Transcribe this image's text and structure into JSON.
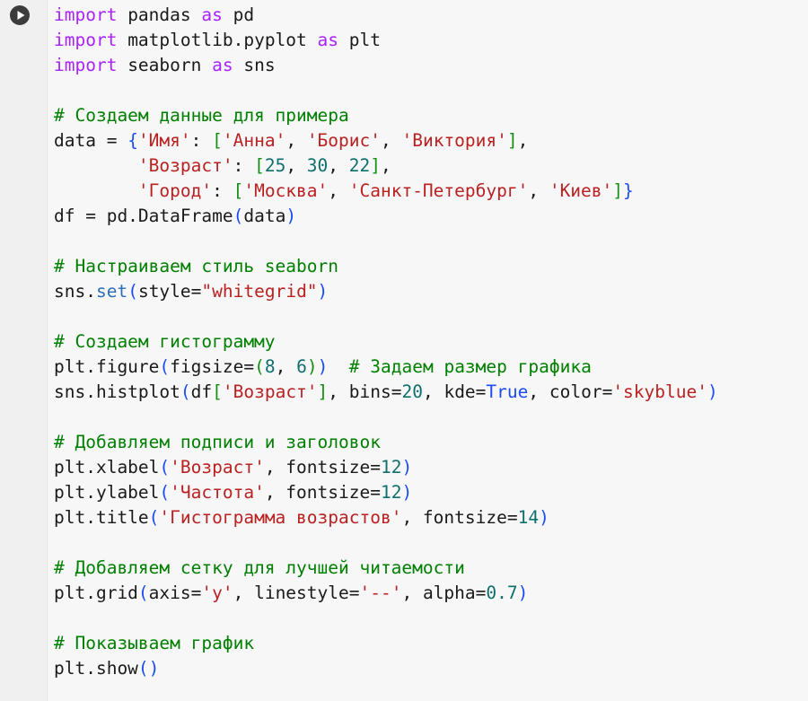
{
  "editor": {
    "kind": "notebook-code-cell",
    "language": "python",
    "background_color": "#f7f7f7",
    "gutter_color": "#f0f0f0",
    "run_button": {
      "icon": "play-icon",
      "label": "Run cell",
      "circle_color": "#3c3c3c",
      "glyph_color": "#ffffff"
    },
    "syntax_colors": {
      "keyword": "#aa22ff",
      "comment": "#008000",
      "string": "#ba2121",
      "number": "#0f6f6f",
      "boolean": "#1a4cf5",
      "function": "#2e6fb7",
      "bracket_level_1": "#1a4cf5",
      "bracket_level_2": "#149014",
      "text": "#1a1a1a"
    }
  },
  "code": {
    "lines": [
      "import pandas as pd",
      "import matplotlib.pyplot as plt",
      "import seaborn as sns",
      "",
      "# Создаем данные для примера",
      "data = {'Имя': ['Анна', 'Борис', 'Виктория'],",
      "        'Возраст': [25, 30, 22],",
      "        'Город': ['Москва', 'Санкт-Петербург', 'Киев']}",
      "df = pd.DataFrame(data)",
      "",
      "# Настраиваем стиль seaborn",
      "sns.set(style=\"whitegrid\")",
      "",
      "# Создаем гистограмму",
      "plt.figure(figsize=(8, 6))  # Задаем размер графика",
      "sns.histplot(df['Возраст'], bins=20, kde=True, color='skyblue')",
      "",
      "# Добавляем подписи и заголовок",
      "plt.xlabel('Возраст', fontsize=12)",
      "plt.ylabel('Частота', fontsize=12)",
      "plt.title('Гистограмма возрастов', fontsize=14)",
      "",
      "# Добавляем сетку для лучшей читаемости",
      "plt.grid(axis='y', linestyle='--', alpha=0.7)",
      "",
      "# Показываем график",
      "plt.show()"
    ],
    "tokens": [
      [
        [
          "import",
          "kw"
        ],
        [
          " pandas ",
          "plain"
        ],
        [
          "as",
          "kw"
        ],
        [
          " pd",
          "plain"
        ]
      ],
      [
        [
          "import",
          "kw"
        ],
        [
          " matplotlib.pyplot ",
          "plain"
        ],
        [
          "as",
          "kw"
        ],
        [
          " plt",
          "plain"
        ]
      ],
      [
        [
          "import",
          "kw"
        ],
        [
          " seaborn ",
          "plain"
        ],
        [
          "as",
          "kw"
        ],
        [
          " sns",
          "plain"
        ]
      ],
      [],
      [
        [
          "# Создаем данные для примера",
          "cmt"
        ]
      ],
      [
        [
          "data = ",
          "plain"
        ],
        [
          "{",
          "b1"
        ],
        [
          "'Имя'",
          "str"
        ],
        [
          ": ",
          "plain"
        ],
        [
          "[",
          "b2"
        ],
        [
          "'Анна'",
          "str"
        ],
        [
          ", ",
          "plain"
        ],
        [
          "'Борис'",
          "str"
        ],
        [
          ", ",
          "plain"
        ],
        [
          "'Виктория'",
          "str"
        ],
        [
          "]",
          "b2"
        ],
        [
          ",",
          "plain"
        ]
      ],
      [
        [
          "        ",
          "plain"
        ],
        [
          "'Возраст'",
          "str"
        ],
        [
          ": ",
          "plain"
        ],
        [
          "[",
          "b2"
        ],
        [
          "25",
          "num"
        ],
        [
          ", ",
          "plain"
        ],
        [
          "30",
          "num"
        ],
        [
          ", ",
          "plain"
        ],
        [
          "22",
          "num"
        ],
        [
          "]",
          "b2"
        ],
        [
          ",",
          "plain"
        ]
      ],
      [
        [
          "        ",
          "plain"
        ],
        [
          "'Город'",
          "str"
        ],
        [
          ": ",
          "plain"
        ],
        [
          "[",
          "b2"
        ],
        [
          "'Москва'",
          "str"
        ],
        [
          ", ",
          "plain"
        ],
        [
          "'Санкт-Петербург'",
          "str"
        ],
        [
          ", ",
          "plain"
        ],
        [
          "'Киев'",
          "str"
        ],
        [
          "]",
          "b2"
        ],
        [
          "}",
          "b1"
        ]
      ],
      [
        [
          "df = pd.DataFrame",
          "plain"
        ],
        [
          "(",
          "b1"
        ],
        [
          "data",
          "plain"
        ],
        [
          ")",
          "b1"
        ]
      ],
      [],
      [
        [
          "# Настраиваем стиль seaborn",
          "cmt"
        ]
      ],
      [
        [
          "sns.",
          "plain"
        ],
        [
          "set",
          "fn"
        ],
        [
          "(",
          "b1"
        ],
        [
          "style=",
          "plain"
        ],
        [
          "\"whitegrid\"",
          "str"
        ],
        [
          ")",
          "b1"
        ]
      ],
      [],
      [
        [
          "# Создаем гистограмму",
          "cmt"
        ]
      ],
      [
        [
          "plt.figure",
          "plain"
        ],
        [
          "(",
          "b1"
        ],
        [
          "figsize=",
          "plain"
        ],
        [
          "(",
          "b2"
        ],
        [
          "8",
          "num"
        ],
        [
          ", ",
          "plain"
        ],
        [
          "6",
          "num"
        ],
        [
          ")",
          "b2"
        ],
        [
          ")",
          "b1"
        ],
        [
          "  ",
          "plain"
        ],
        [
          "# Задаем размер графика",
          "cmt"
        ]
      ],
      [
        [
          "sns.histplot",
          "plain"
        ],
        [
          "(",
          "b1"
        ],
        [
          "df",
          "plain"
        ],
        [
          "[",
          "b2"
        ],
        [
          "'Возраст'",
          "str"
        ],
        [
          "]",
          "b2"
        ],
        [
          ", bins=",
          "plain"
        ],
        [
          "20",
          "num"
        ],
        [
          ", kde=",
          "plain"
        ],
        [
          "True",
          "bool"
        ],
        [
          ", color=",
          "plain"
        ],
        [
          "'skyblue'",
          "str"
        ],
        [
          ")",
          "b1"
        ]
      ],
      [],
      [
        [
          "# Добавляем подписи и заголовок",
          "cmt"
        ]
      ],
      [
        [
          "plt.xlabel",
          "plain"
        ],
        [
          "(",
          "b1"
        ],
        [
          "'Возраст'",
          "str"
        ],
        [
          ", fontsize=",
          "plain"
        ],
        [
          "12",
          "num"
        ],
        [
          ")",
          "b1"
        ]
      ],
      [
        [
          "plt.ylabel",
          "plain"
        ],
        [
          "(",
          "b1"
        ],
        [
          "'Частота'",
          "str"
        ],
        [
          ", fontsize=",
          "plain"
        ],
        [
          "12",
          "num"
        ],
        [
          ")",
          "b1"
        ]
      ],
      [
        [
          "plt.title",
          "plain"
        ],
        [
          "(",
          "b1"
        ],
        [
          "'Гистограмма возрастов'",
          "str"
        ],
        [
          ", fontsize=",
          "plain"
        ],
        [
          "14",
          "num"
        ],
        [
          ")",
          "b1"
        ]
      ],
      [],
      [
        [
          "# Добавляем сетку для лучшей читаемости",
          "cmt"
        ]
      ],
      [
        [
          "plt.grid",
          "plain"
        ],
        [
          "(",
          "b1"
        ],
        [
          "axis=",
          "plain"
        ],
        [
          "'y'",
          "str"
        ],
        [
          ", linestyle=",
          "plain"
        ],
        [
          "'--'",
          "str"
        ],
        [
          ", alpha=",
          "plain"
        ],
        [
          "0.7",
          "num"
        ],
        [
          ")",
          "b1"
        ]
      ],
      [],
      [
        [
          "# Показываем график",
          "cmt"
        ]
      ],
      [
        [
          "plt.show",
          "plain"
        ],
        [
          "(",
          "b1"
        ],
        [
          ")",
          "b1"
        ]
      ]
    ]
  }
}
